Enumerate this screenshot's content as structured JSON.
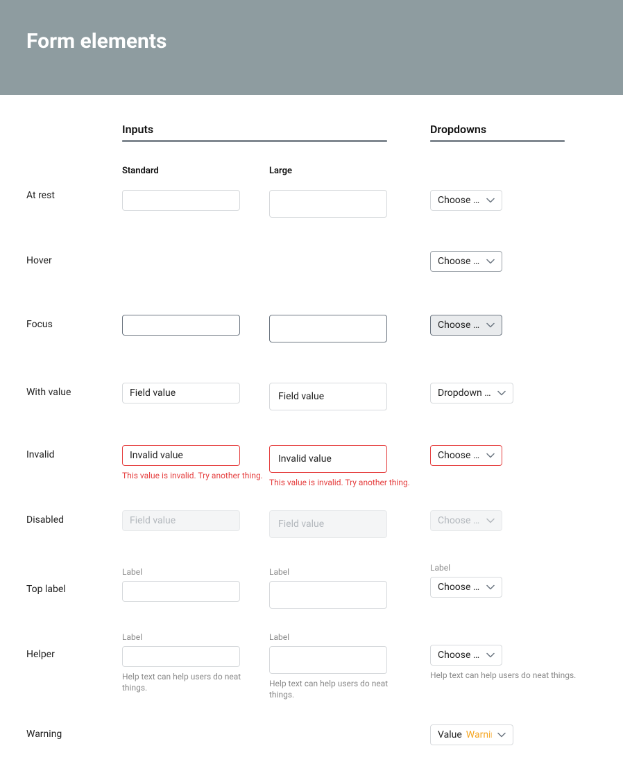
{
  "hero": {
    "title": "Form elements"
  },
  "sections": {
    "inputs": {
      "title": "Inputs",
      "sub_standard": "Standard",
      "sub_large": "Large"
    },
    "dropdowns": {
      "title": "Dropdowns"
    }
  },
  "states": {
    "at_rest": "At rest",
    "hover": "Hover",
    "focus": "Focus",
    "with_value": "With value",
    "invalid": "Invalid",
    "disabled": "Disabled",
    "top_label": "Top label",
    "helper": "Helper",
    "warning": "Warning"
  },
  "values": {
    "field_value": "Field value",
    "invalid_value": "Invalid value",
    "dropdown_value": "Dropdown value",
    "choose_one": "Choose one…",
    "value": "Value",
    "warning": "Warning"
  },
  "labels": {
    "label": "Label"
  },
  "messages": {
    "invalid": "This value is invalid. Try another thing.",
    "help": "Help text can help users do neat things."
  }
}
